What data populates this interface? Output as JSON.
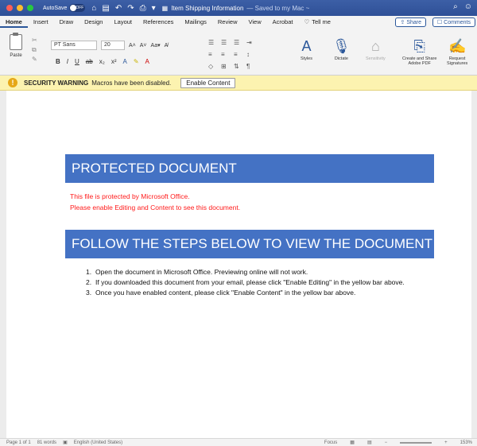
{
  "titlebar": {
    "autosave_label": "AutoSave",
    "autosave_state": "OFF",
    "doc_title": "Item Shipping Information",
    "saved_status": "— Saved to my Mac ~",
    "traffic_colors": [
      "#ff5f57",
      "#febc2e",
      "#28c840"
    ]
  },
  "tabs": [
    {
      "label": "Home",
      "active": true
    },
    {
      "label": "Insert"
    },
    {
      "label": "Draw"
    },
    {
      "label": "Design"
    },
    {
      "label": "Layout"
    },
    {
      "label": "References"
    },
    {
      "label": "Mailings"
    },
    {
      "label": "Review"
    },
    {
      "label": "View"
    },
    {
      "label": "Acrobat"
    }
  ],
  "tellme": "Tell me",
  "share": "Share",
  "comments": "Comments",
  "ribbon": {
    "paste": "Paste",
    "font_name": "PT Sans",
    "font_size": "20",
    "styles": "Styles",
    "dictate": "Dictate",
    "sensitivity": "Sensitivity",
    "create_share_1": "Create and Share",
    "create_share_2": "Adobe PDF",
    "request_1": "Request",
    "request_2": "Signatures"
  },
  "security": {
    "label": "SECURITY WARNING",
    "message": "Macros have been disabled.",
    "button": "Enable Content"
  },
  "document": {
    "heading1": "PROTECTED DOCUMENT",
    "red_line1": "This file is protected by Microsoft Office.",
    "red_line2": "Please enable Editing and Content to see this document.",
    "heading2": "FOLLOW THE STEPS BELOW TO VIEW THE DOCUMENT",
    "steps": [
      {
        "num": "1.",
        "text": "Open the document in Microsoft Office. Previewing online will not work."
      },
      {
        "num": "2.",
        "text": "If you downloaded this document from your email, please click \"Enable Editing\" in the yellow bar above."
      },
      {
        "num": "3.",
        "text": "Once you have enabled content, please click \"Enable Content\" in the yellow bar above."
      }
    ],
    "banner_color": "#4472c4",
    "warning_text_color": "#ff1a1a"
  },
  "status": {
    "page": "Page 1 of 1",
    "words": "81 words",
    "language": "English (United States)",
    "focus": "Focus",
    "zoom": "153%"
  }
}
